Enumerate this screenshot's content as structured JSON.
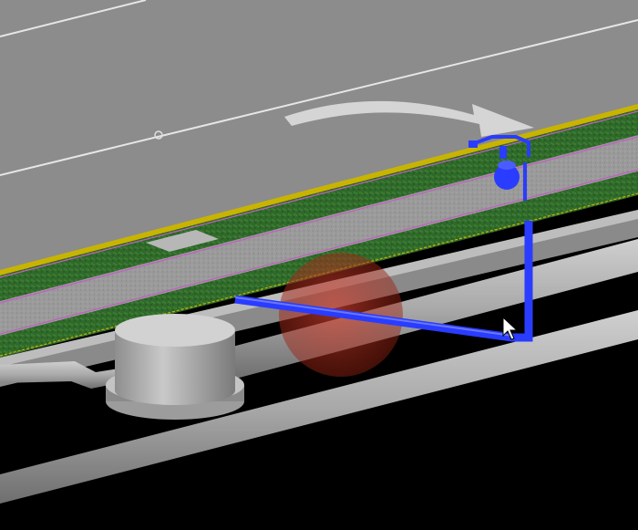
{
  "viewport": {
    "view_mode": "3d-perspective",
    "background_color": "#000000"
  },
  "scene": {
    "road_surface": {
      "name": "road-surface",
      "color": "#8c8c8c"
    },
    "lane_markings": {
      "color": "#e6e6e6"
    },
    "curb": {
      "color": "#c8b400"
    },
    "grass_strip_near": {
      "color": "#2f6a2a"
    },
    "sidewalk": {
      "color": "#9a9a9a"
    },
    "grass_strip_far": {
      "color": "#2f6a2a"
    },
    "boundary_lines": {
      "color": "#c060c0"
    },
    "storm_pipes": {
      "color": "#a8a8a8"
    },
    "manhole": {
      "color": "#b5b5b5"
    },
    "selected_pipe": {
      "color": "#2a3cff",
      "state": "selected"
    },
    "fire_hydrant": {
      "color": "#2a3cff",
      "icon": "fire-hydrant-icon"
    },
    "conflict_marker": {
      "color": "#c03020",
      "opacity": 0.55
    },
    "direction_arrow": {
      "color": "#d9d9d9",
      "icon": "curved-arrow-icon"
    },
    "grip_point": {
      "icon": "grip-circle-icon"
    },
    "cursor": {
      "icon": "arrow-cursor-icon"
    }
  }
}
